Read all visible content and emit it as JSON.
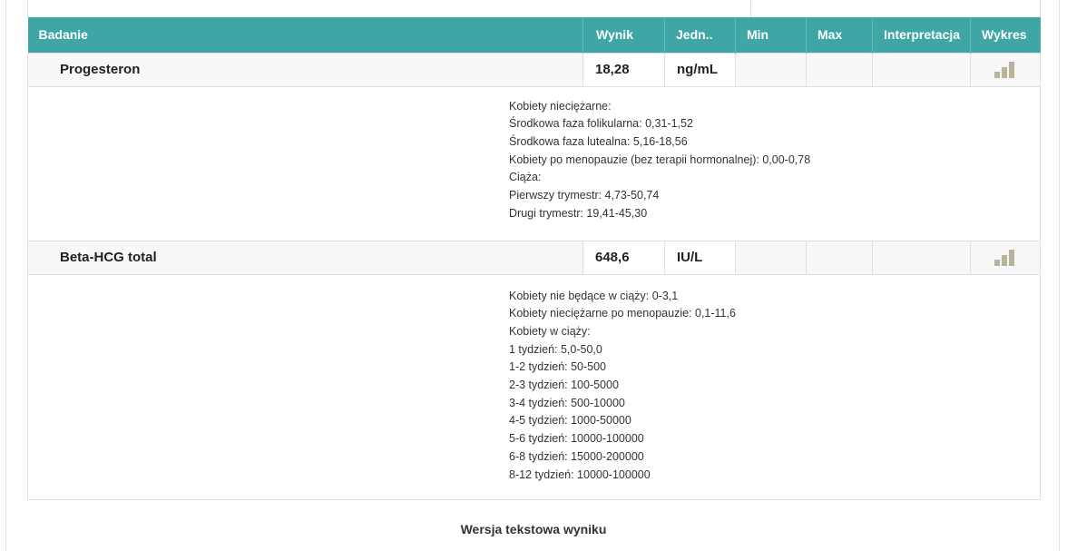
{
  "table": {
    "headers": {
      "badanie": "Badanie",
      "wynik": "Wynik",
      "jedn": "Jedn..",
      "min": "Min",
      "max": "Max",
      "interpretacja": "Interpretacja",
      "wykres": "Wykres"
    },
    "tests": [
      {
        "name": "Progesteron",
        "value": "18,28",
        "unit": "ng/mL",
        "min": "",
        "max": "",
        "interpretation": "",
        "chart_icon": "bar-chart-icon",
        "reference": [
          "Kobiety nieciężarne:",
          "Środkowa faza folikularna: 0,31-1,52",
          "Środkowa faza lutealna: 5,16-18,56",
          "Kobiety po menopauzie (bez terapii hormonalnej): 0,00-0,78",
          "Ciąża:",
          "Pierwszy trymestr: 4,73-50,74",
          "Drugi trymestr: 19,41-45,30"
        ]
      },
      {
        "name": "Beta-HCG total",
        "value": "648,6",
        "unit": "IU/L",
        "min": "",
        "max": "",
        "interpretation": "",
        "chart_icon": "bar-chart-icon",
        "reference": [
          "Kobiety nie będące w ciąży: 0-3,1",
          "Kobiety nieciężarne po menopauzie: 0,1-11,6",
          "Kobiety w ciąży:",
          "1 tydzień: 5,0-50,0",
          "1-2 tydzień: 50-500",
          "2-3 tydzień: 100-5000",
          "3-4 tydzień: 500-10000",
          "4-5 tydzień: 1000-50000",
          "5-6 tydzień: 10000-100000",
          "6-8 tydzień: 15000-200000",
          "8-12 tydzień: 10000-100000"
        ]
      }
    ]
  },
  "footer": {
    "title": "Wersja tekstowa wyniku"
  },
  "colors": {
    "header_bg": "#3fa6a6",
    "icon": "#b7b49b"
  }
}
